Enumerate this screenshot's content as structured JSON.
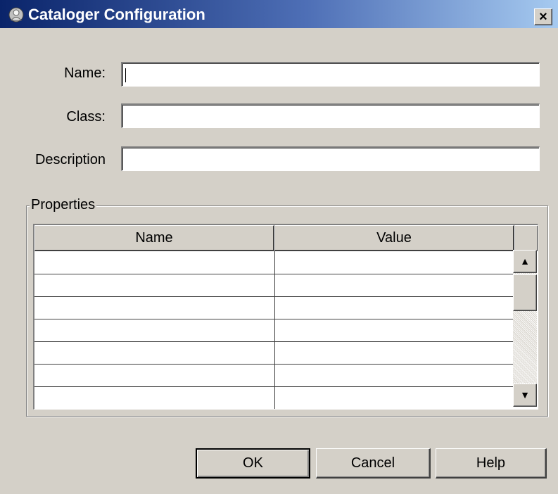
{
  "window": {
    "title": "Cataloger Configuration",
    "close_glyph": "×",
    "icon": "cataloger-app-icon"
  },
  "form": {
    "name_label": "Name:",
    "name_value": "",
    "class_label": "Class:",
    "class_value": "",
    "description_label": "Description",
    "description_value": ""
  },
  "properties": {
    "group_title": "Properties",
    "columns": [
      "Name",
      "Value"
    ],
    "rows": [
      {
        "name": "",
        "value": ""
      },
      {
        "name": "",
        "value": ""
      },
      {
        "name": "",
        "value": ""
      },
      {
        "name": "",
        "value": ""
      },
      {
        "name": "",
        "value": ""
      },
      {
        "name": "",
        "value": ""
      },
      {
        "name": "",
        "value": ""
      }
    ],
    "scroll_up_glyph": "▲",
    "scroll_down_glyph": "▼"
  },
  "buttons": {
    "ok": "OK",
    "cancel": "Cancel",
    "help": "Help"
  },
  "colors": {
    "titlebar_start": "#0a246a",
    "titlebar_end": "#a6caf0",
    "dialog_bg": "#d4d0c8"
  }
}
